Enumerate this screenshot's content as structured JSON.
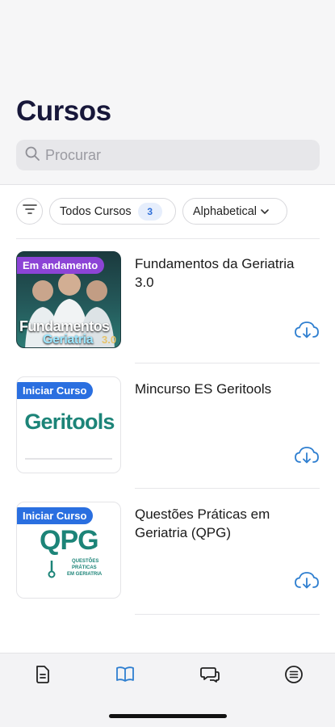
{
  "header": {
    "title": "Cursos",
    "search_placeholder": "Procurar"
  },
  "filters": {
    "all_label": "Todos Cursos",
    "all_count": "3",
    "sort_label": "Alphabetical"
  },
  "courses": [
    {
      "title": "Fundamentos da Geriatria 3.0",
      "status": "Em andamento",
      "thumb_text_1": "Fundamentos",
      "thumb_text_2": "Geriatria",
      "thumb_text_3": "3.0"
    },
    {
      "title": "Mincurso ES Geritools",
      "status": "Iniciar Curso",
      "logo_text": "Geritools"
    },
    {
      "title": "Questões Práticas em Geriatria (QPG)",
      "status": "Iniciar Curso",
      "logo_text": "QPG",
      "logo_caption_1": "QUESTÕES",
      "logo_caption_2": "PRÁTICAS",
      "logo_caption_3": "EM GERIATRIA"
    }
  ],
  "tabbar": {
    "items": [
      "document-icon",
      "book-icon",
      "chat-icon",
      "menu-icon"
    ],
    "active_index": 1
  },
  "colors": {
    "accent": "#2f7fd0",
    "title": "#17173a",
    "badge_progress": "#8c44d6",
    "badge_start": "#2a6fe0",
    "brand_teal": "#1c8478"
  }
}
